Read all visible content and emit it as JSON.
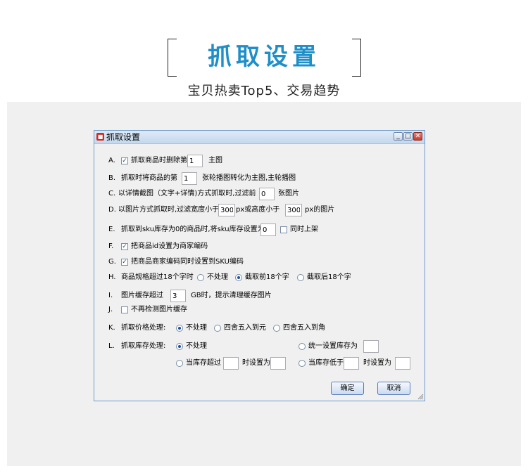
{
  "hero": {
    "title": "抓取设置",
    "subtitle": "宝贝热卖Top5、交易趋势"
  },
  "dialog": {
    "title": "抓取设置",
    "window_buttons": {
      "minimize": "_",
      "maximize": "□",
      "close": "✕"
    },
    "options": {
      "A": {
        "letter": "A.",
        "checked": true,
        "label": "抓取商品时删除第",
        "value": "1",
        "suffix": "主图"
      },
      "B": {
        "letter": "B.",
        "label": "抓取时将商品的第",
        "value": "1",
        "suffix": "张轮播图转化为主图,主轮播图"
      },
      "C": {
        "letter": "C.",
        "label": "以详情截图（文字+详情)方式抓取时,过滤前",
        "value": "0",
        "suffix": "张图片"
      },
      "D": {
        "letter": "D.",
        "label": "以图片方式抓取时,过滤宽度小于",
        "width_value": "300",
        "mid": "px或高度小于",
        "height_value": "300",
        "suffix": "px的图片"
      },
      "E": {
        "letter": "E.",
        "label": "抓取到sku库存为0的商品时,将sku库存设置为",
        "value": "0",
        "check_checked": false,
        "check_label": "同时上架"
      },
      "F": {
        "letter": "F.",
        "checked": true,
        "label": "把商品id设置为商家编码"
      },
      "G": {
        "letter": "G.",
        "checked": true,
        "label": "把商品商家编码同时设置到SKU编码"
      },
      "H": {
        "letter": "H.",
        "label": "商品规格超过18个字时",
        "radios": [
          "不处理",
          "截取前18个字",
          "截取后18个字"
        ],
        "selected": "截取前18个字"
      },
      "I": {
        "letter": "I.",
        "label": "图片缓存超过",
        "value": "3",
        "suffix": "GB时，提示清理缓存图片"
      },
      "J": {
        "letter": "J.",
        "checked": false,
        "label": "不再检测图片缓存"
      },
      "K": {
        "letter": "K.",
        "label": "抓取价格处理:",
        "radios": [
          "不处理",
          "四舍五入到元",
          "四舍五入到角"
        ],
        "selected": "不处理"
      },
      "L": {
        "letter": "L.",
        "label": "抓取库存处理:",
        "radio_none": "不处理",
        "radio_unify": "统一设置库存为",
        "unify_value": "",
        "radio_over": "当库存超过",
        "over_value": "",
        "over_set": "时设置为",
        "over_set_value": "",
        "radio_below": "当库存低于",
        "below_value": "",
        "below_set": "时设置为",
        "below_set_value": "",
        "selected": "不处理"
      }
    },
    "buttons": {
      "ok": "确定",
      "cancel": "取消"
    }
  }
}
